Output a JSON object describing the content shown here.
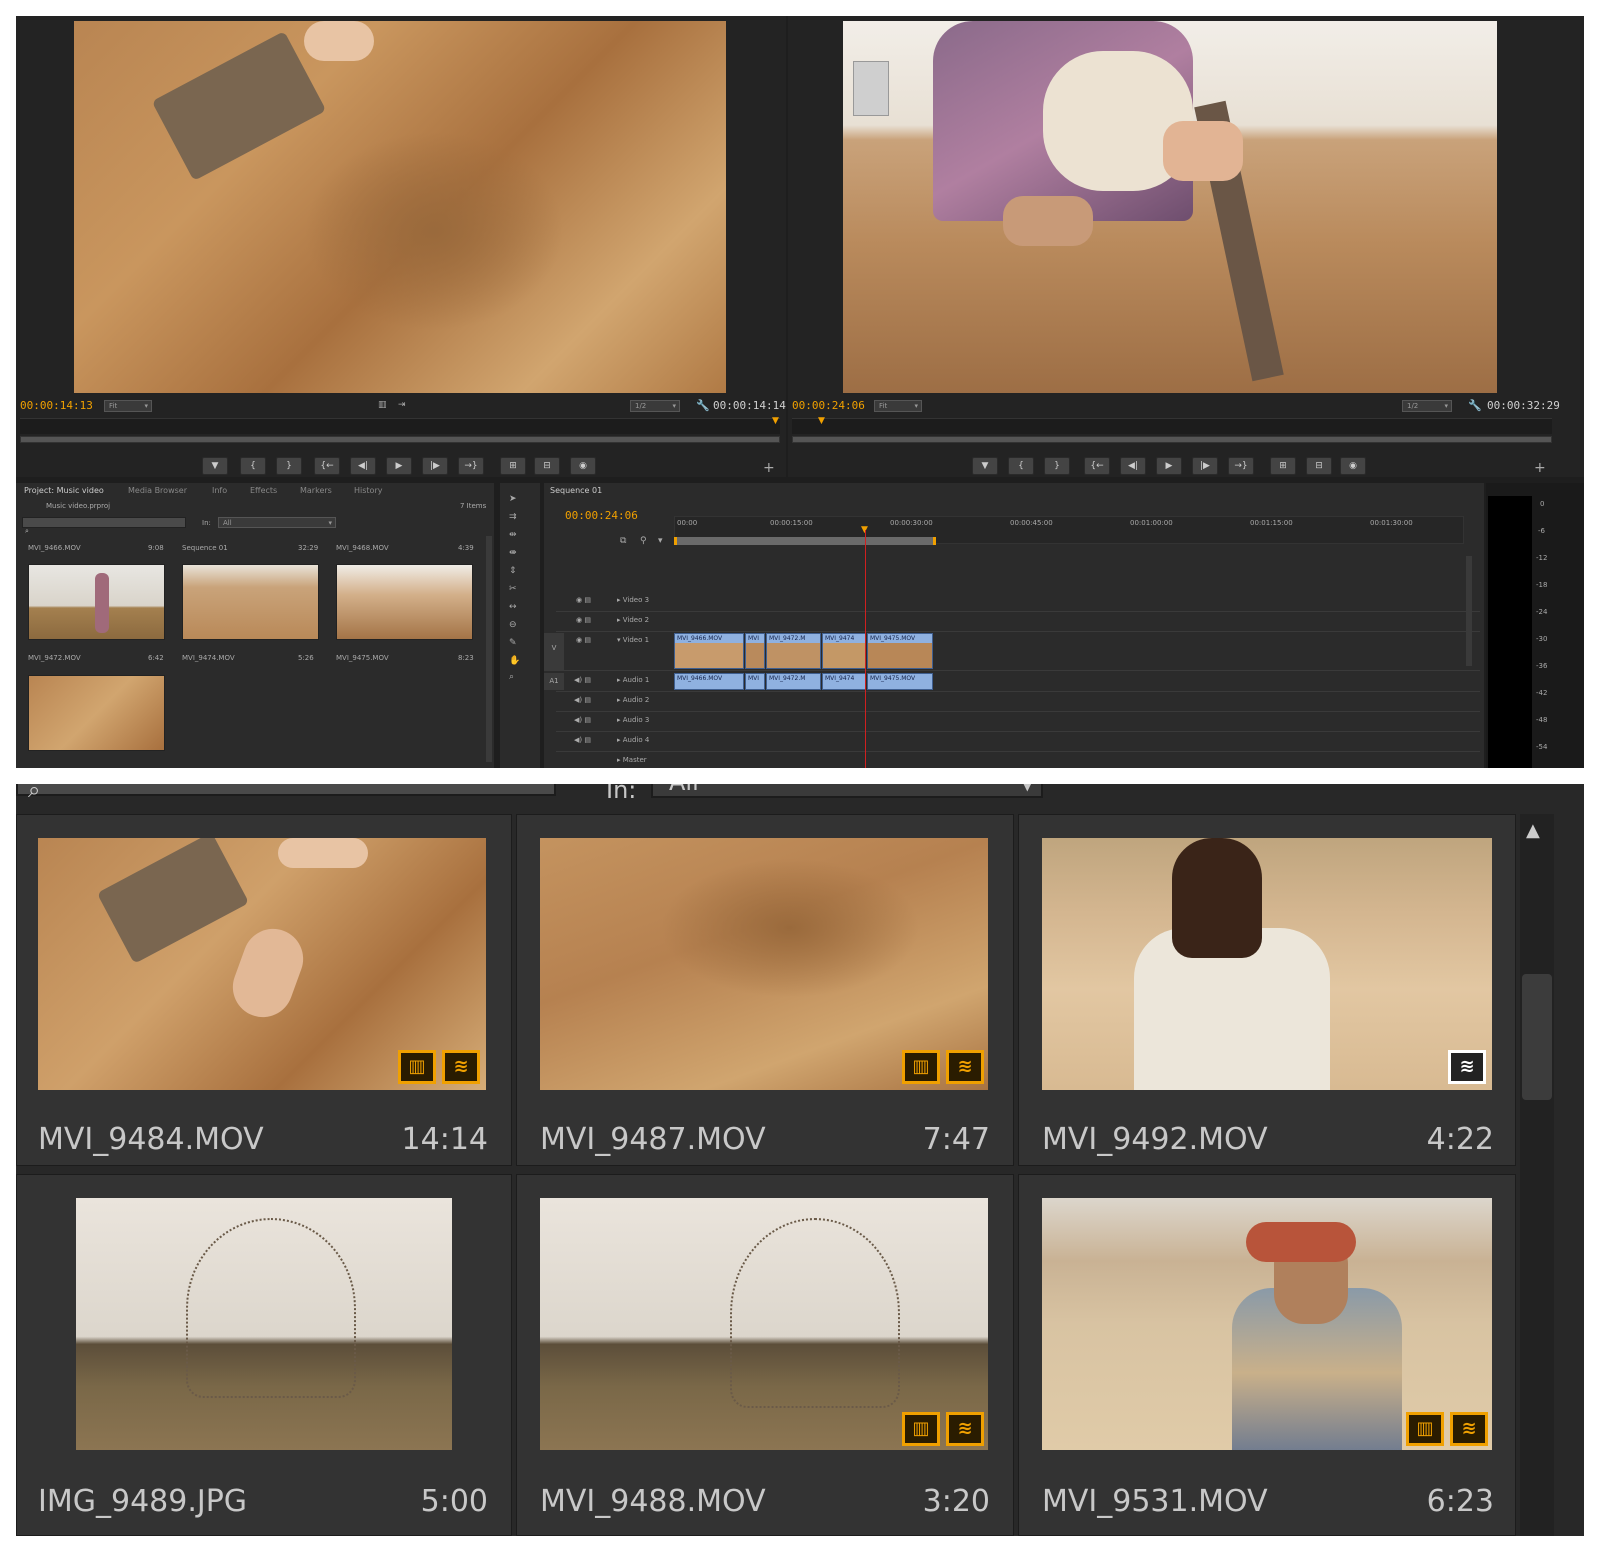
{
  "source_monitor": {
    "timecode_in": "00:00:14:13",
    "zoom": "Fit",
    "resolution": "1/2",
    "duration": "00:00:14:14"
  },
  "program_monitor": {
    "timecode_in": "00:00:24:06",
    "zoom": "Fit",
    "resolution": "1/2",
    "duration": "00:00:32:29"
  },
  "project_panel": {
    "tabs": [
      "Project: Music video",
      "Media Browser",
      "Info",
      "Effects",
      "Markers",
      "History"
    ],
    "file": "Music video.prproj",
    "item_count": "7 Items",
    "in_label": "In:",
    "in_value": "All",
    "items": [
      {
        "name": "MVI_9466.MOV",
        "duration": "9:08"
      },
      {
        "name": "Sequence 01",
        "duration": "32:29"
      },
      {
        "name": "MVI_9468.MOV",
        "duration": "4:39"
      },
      {
        "name": "MVI_9472.MOV",
        "duration": "6:42"
      },
      {
        "name": "MVI_9474.MOV",
        "duration": "5:26"
      },
      {
        "name": "MVI_9475.MOV",
        "duration": "8:23"
      }
    ]
  },
  "timeline": {
    "tab": "Sequence 01",
    "timecode": "00:00:24:06",
    "ruler": [
      "00:00",
      "00:00:15:00",
      "00:00:30:00",
      "00:00:45:00",
      "00:01:00:00",
      "00:01:15:00",
      "00:01:30:00"
    ],
    "tracks": [
      "Video 3",
      "Video 2",
      "Video 1",
      "Audio 1",
      "Audio 2",
      "Audio 3",
      "Audio 4",
      "Master"
    ],
    "v_label": "V",
    "a_label": "A1",
    "video_clips": [
      "MVI_9466.MOV",
      "MVI",
      "MVI_9472.M",
      "MVI_9474",
      "MVI_9475.MOV"
    ],
    "audio_clips": [
      "MVI_9466.MOV",
      "MVI",
      "MVI_9472.M",
      "MVI_9474",
      "MVI_9475.MOV"
    ]
  },
  "meter_scale": [
    "0",
    "-6",
    "-12",
    "-18",
    "-24",
    "-30",
    "-36",
    "-42",
    "-48",
    "-54"
  ],
  "zoom_view": {
    "in_label": "In:",
    "in_value": "All",
    "items": [
      {
        "name": "MVI_9484.MOV",
        "duration": "14:14"
      },
      {
        "name": "MVI_9487.MOV",
        "duration": "7:47"
      },
      {
        "name": "MVI_9492.MOV",
        "duration": "4:22"
      },
      {
        "name": "IMG_9489.JPG",
        "duration": "5:00"
      },
      {
        "name": "MVI_9488.MOV",
        "duration": "3:20"
      },
      {
        "name": "MVI_9531.MOV",
        "duration": "6:23"
      }
    ]
  },
  "colors": {
    "accent": "#f0a000",
    "clip": "#8fb1e0",
    "playhead": "#d02020"
  }
}
